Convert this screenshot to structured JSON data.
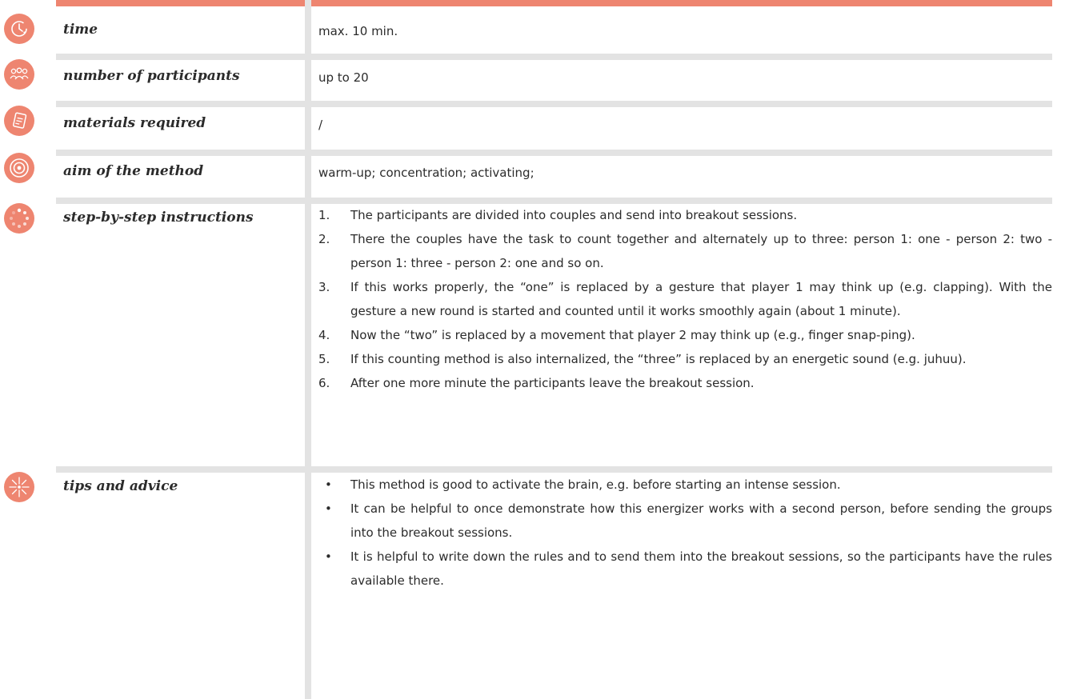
{
  "rows": [
    {
      "icon": "clock-icon",
      "label": "time",
      "value": "max. 10 min."
    },
    {
      "icon": "participants-icon",
      "label": "number of participants",
      "value": "up to 20"
    },
    {
      "icon": "materials-icon",
      "label": "materials required",
      "value": "/"
    },
    {
      "icon": "target-icon",
      "label": "aim of the method",
      "value": "warm-up; concentration; activating;"
    }
  ],
  "instructions": {
    "icon": "steps-icon",
    "label": "step-by-step instructions",
    "steps": [
      {
        "num": "1.",
        "text": "The participants are divided into couples and send into breakout sessions."
      },
      {
        "num": "2.",
        "text": "There the couples have the task to count together and alternately up to three: person 1: one - person 2: two - person 1: three - person 2: one and so on."
      },
      {
        "num": "3.",
        "text": "If this works properly, the “one” is replaced by a gesture that player 1 may think up (e.g. clapping). With the gesture a new round is started and counted until it works smoothly again (about 1 minute)."
      },
      {
        "num": "4.",
        "text": "Now the “two” is replaced by a movement that player 2 may think up (e.g., finger snap-ping)."
      },
      {
        "num": "5.",
        "text": "If this counting method is also internalized, the “three” is replaced by an energetic sound (e.g. juhuu)."
      },
      {
        "num": "6.",
        "text": "After one more minute the participants leave the breakout session."
      }
    ]
  },
  "tips": {
    "icon": "sparkle-icon",
    "label": "tips and advice",
    "items": [
      "This method is good to activate the brain, e.g. before starting an intense session.",
      "It can be helpful to once demonstrate how this energizer works with a second person, before sending the groups into the breakout sessions.",
      "It is helpful to write down the rules and to send them into the breakout sessions, so the participants have the rules available there."
    ],
    "bullet": "•"
  },
  "colors": {
    "accent": "#ee8570",
    "divider": "#e3e3e3",
    "text": "#2b2b2b"
  }
}
